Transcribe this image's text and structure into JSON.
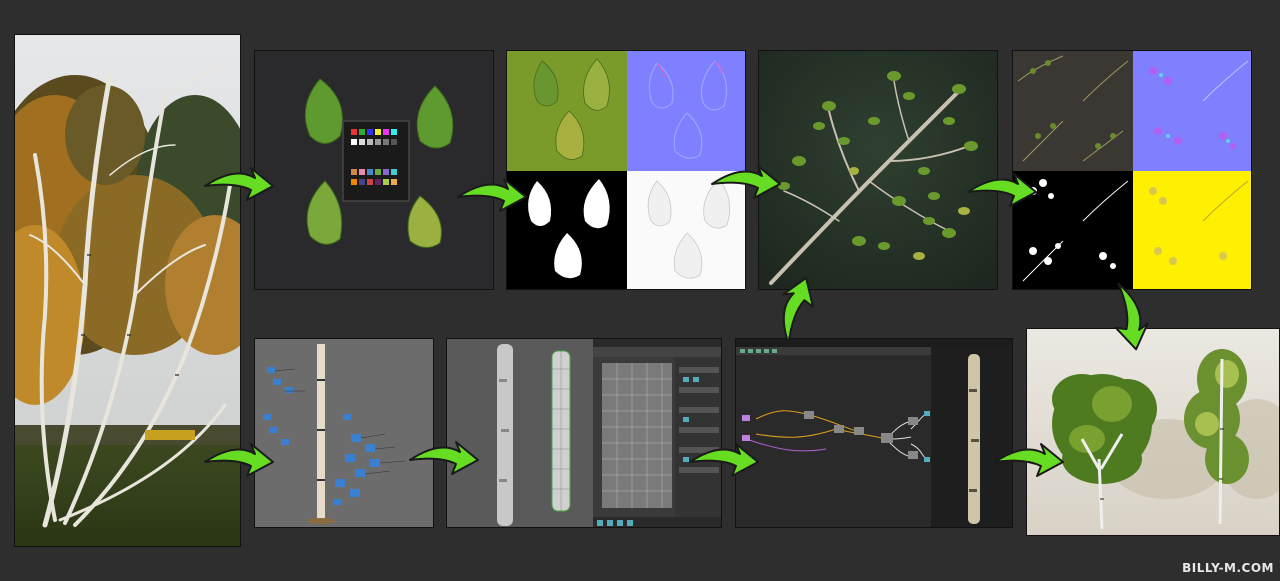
{
  "watermark": {
    "text": "BILLY-M.COM"
  },
  "colors": {
    "background": "#2e2e2e",
    "arrow_fill": "#66dd22",
    "arrow_outline": "#1a1a1a"
  },
  "icons": {
    "arrow": "curved-green-arrow-icon"
  },
  "panels": [
    {
      "id": "reference-photo",
      "icon": "birch-tree-photo"
    },
    {
      "id": "leaf-scan",
      "icon": "leaves-with-color-checker"
    },
    {
      "id": "leaf-texture-maps",
      "icon": "albedo-normal-opacity-ao-maps"
    },
    {
      "id": "branch-render",
      "icon": "birch-branch-3d"
    },
    {
      "id": "branch-atlas",
      "icon": "branch-atlas-maps"
    },
    {
      "id": "bark-photogrammetry",
      "icon": "photogrammetry-cameras"
    },
    {
      "id": "bark-retopology",
      "icon": "trunk-mesh-uv-editor"
    },
    {
      "id": "bark-node-graph",
      "icon": "node-graph-editor"
    },
    {
      "id": "final-trees-render",
      "icon": "final-birch-trees"
    }
  ]
}
